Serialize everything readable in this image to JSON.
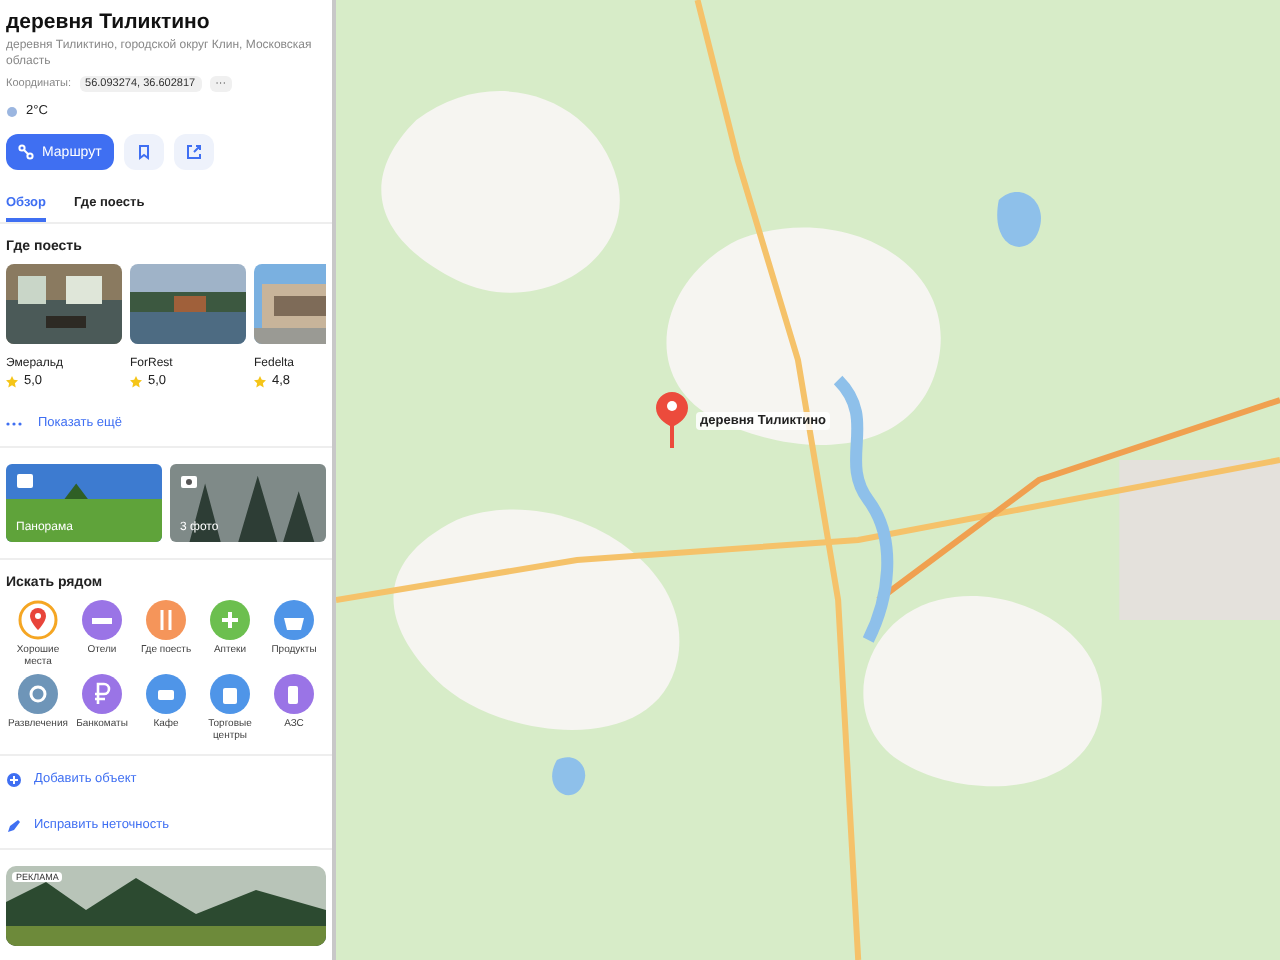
{
  "place": {
    "title": "деревня Тиликтино",
    "address": "деревня Тиликтино, городской округ Клин, Московская область",
    "coords_label": "Координаты:",
    "coords": "56.093274, 36.602817",
    "coords_more": "···",
    "weather": "2°C"
  },
  "actions": {
    "route": "Маршрут"
  },
  "tabs": [
    {
      "label": "Обзор",
      "selected": true
    },
    {
      "label": "Где поесть",
      "selected": false
    }
  ],
  "food": {
    "title": "Где поесть",
    "items": [
      {
        "name": "Эмеральд",
        "rating": "5,0"
      },
      {
        "name": "ForRest",
        "rating": "5,0"
      },
      {
        "name": "Fedelta",
        "rating": "4,8"
      }
    ],
    "more": "Показать ещё"
  },
  "photos": [
    {
      "label": "Панорама"
    },
    {
      "label": "3 фото"
    }
  ],
  "nearby": {
    "title": "Искать рядом",
    "items": [
      {
        "label": "Хорошие места",
        "color": "#f5a623"
      },
      {
        "label": "Отели",
        "color": "#9a74e6"
      },
      {
        "label": "Где поесть",
        "color": "#f5955a"
      },
      {
        "label": "Аптеки",
        "color": "#6cbf4f"
      },
      {
        "label": "Продукты",
        "color": "#4f95e8"
      },
      {
        "label": "Развлечения",
        "color": "#6e95b8"
      },
      {
        "label": "Банкоматы",
        "color": "#9a74e6"
      },
      {
        "label": "Кафе",
        "color": "#4f95e8"
      },
      {
        "label": "Торговые центры",
        "color": "#4f95e8"
      },
      {
        "label": "АЗС",
        "color": "#9a74e6"
      }
    ]
  },
  "links": [
    {
      "label": "Добавить объект"
    },
    {
      "label": "Исправить неточность"
    }
  ],
  "ad": {
    "badge": "РЕКЛАМА"
  },
  "map": {
    "marker_label": "деревня Тиликтино"
  }
}
